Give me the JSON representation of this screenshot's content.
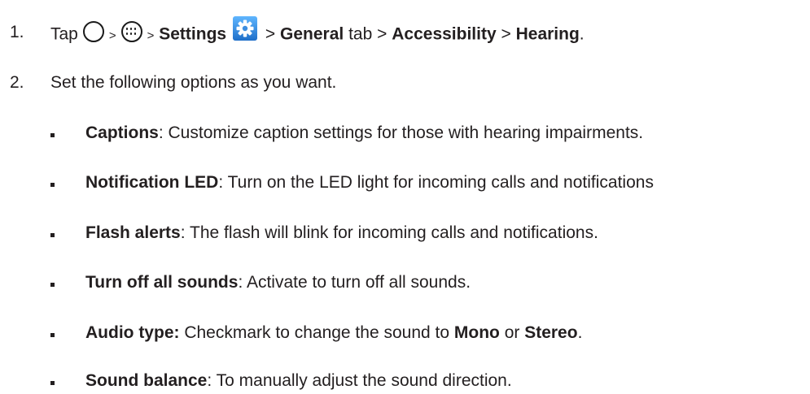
{
  "steps": [
    {
      "number": "1.",
      "parts": {
        "tap": "Tap",
        "sep1": ">",
        "sep2": ">",
        "settings": "Settings",
        "sep3": ">",
        "general": "General",
        "tab": "tab",
        "sep4": ">",
        "accessibility": "Accessibility",
        "sep5": ">",
        "hearing": "Hearing",
        "period": "."
      }
    },
    {
      "number": "2.",
      "text": "Set the following options as you want."
    }
  ],
  "options": [
    {
      "term": "Captions",
      "desc": ": Customize caption settings for those with hearing impairments."
    },
    {
      "term": "Notification LED",
      "desc": ": Turn on the LED light for incoming calls and notifications"
    },
    {
      "term": "Flash alerts",
      "desc": ": The flash will blink for incoming calls and notifications."
    },
    {
      "term": "Turn off all sounds",
      "desc": ": Activate to turn off all sounds."
    },
    {
      "term": "Audio type:",
      "desc": " Checkmark to change the sound to ",
      "mono": "Mono",
      "or": " or ",
      "stereo": "Stereo",
      "end": "."
    },
    {
      "term": "Sound balance",
      "desc": ": To manually adjust the sound direction."
    }
  ],
  "icons": {
    "home": "circle-home-icon",
    "apps": "apps-grid-icon",
    "settings": "settings-gear-icon"
  }
}
